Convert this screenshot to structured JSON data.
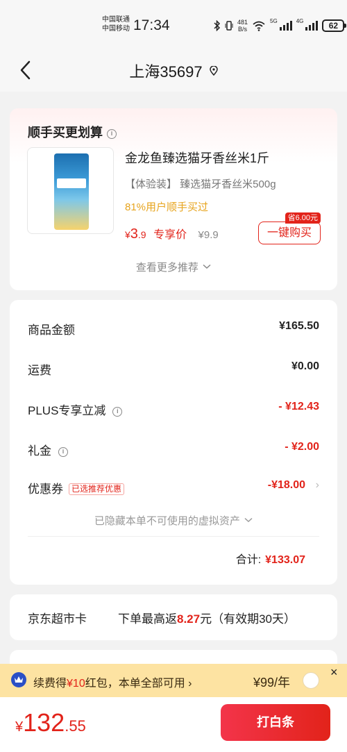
{
  "status_bar": {
    "carrier1": "中国联通",
    "carrier2": "中国移动",
    "time": "17:34",
    "net_speed_value": "481",
    "net_speed_unit": "B/s",
    "signal1_label": "5G",
    "signal2_label": "4G",
    "battery": "62",
    "icons": [
      "bluetooth-icon",
      "vibrate-icon",
      "wifi-icon",
      "signal-icon",
      "battery-icon"
    ]
  },
  "header": {
    "back_icon": "chevron-left-icon",
    "title": "上海35697",
    "location_icon": "pin-icon"
  },
  "recommend": {
    "title": "顺手买更划算",
    "product": {
      "name": "金龙鱼臻选猫牙香丝米1斤",
      "spec": "【体验装】 臻选猫牙香丝米500g",
      "bought_by": "81%用户顺手买过",
      "currency": "¥",
      "price": "3.9",
      "price_int": "3",
      "price_dec": ".9",
      "exclusive_label": "专享价",
      "original_price": "¥9.9",
      "save_tag": "省6.00元",
      "buy_label": "一键购买"
    },
    "more_label": "查看更多推荐"
  },
  "summary": {
    "rows": [
      {
        "label": "商品金额",
        "value": "¥165.50"
      },
      {
        "label": "运费",
        "value": "¥0.00"
      },
      {
        "label": "PLUS专享立减",
        "value": "- ¥12.43"
      },
      {
        "label": "礼金",
        "value": "- ¥2.00"
      },
      {
        "label": "优惠券",
        "tag": "已选推荐优惠",
        "value": "-¥18.00"
      }
    ],
    "hidden_assets": "已隐藏本单不可使用的虚拟资产",
    "total_label": "合计:",
    "total_value": "¥133.07"
  },
  "supermarket_card": {
    "name": "京东超市卡",
    "desc_prefix": "下单最高返",
    "desc_amount": "8.27",
    "desc_suffix": "元（有效期30天）"
  },
  "renew_bar": {
    "text_prefix": "续费得",
    "text_amount": "¥10",
    "text_suffix": "红包，本单全部可用 ›",
    "price": "¥99/年",
    "close": "×"
  },
  "bottom_bar": {
    "currency": "¥",
    "amount_int": "132",
    "amount_dec": ".55",
    "pay_label": "打白条"
  },
  "colors": {
    "accent_red": "#e2231a",
    "orange_text": "#e7a41d",
    "renew_bg": "#fde3a2"
  }
}
